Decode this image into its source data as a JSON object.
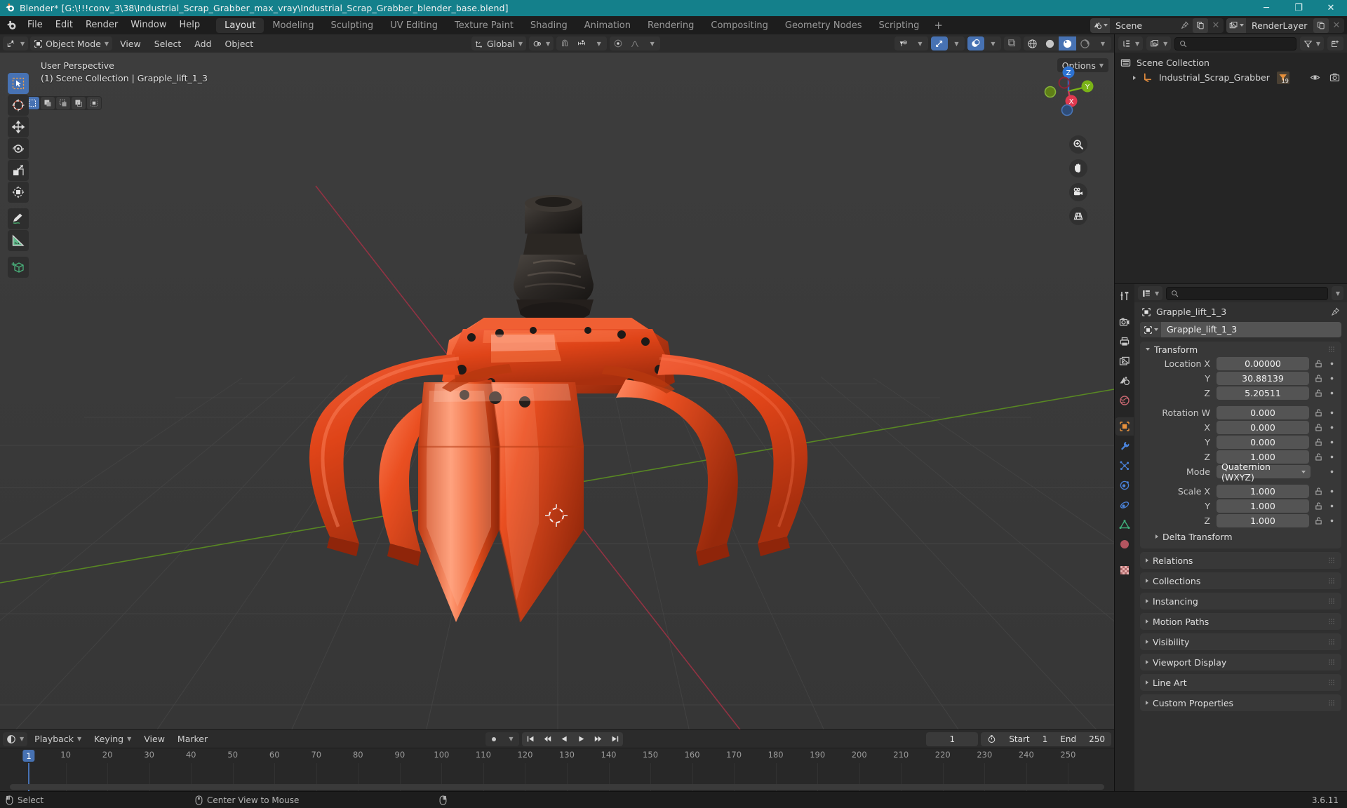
{
  "window": {
    "title": "Blender* [G:\\!!!conv_3\\38\\Industrial_Scrap_Grabber_max_vray\\Industrial_Scrap_Grabber_blender_base.blend]",
    "minimize": "─",
    "maximize": "❐",
    "close": "✕"
  },
  "topbar": {
    "menus": [
      "File",
      "Edit",
      "Render",
      "Window",
      "Help"
    ],
    "workspaces": [
      {
        "label": "Layout",
        "active": true
      },
      {
        "label": "Modeling",
        "active": false
      },
      {
        "label": "Sculpting",
        "active": false
      },
      {
        "label": "UV Editing",
        "active": false
      },
      {
        "label": "Texture Paint",
        "active": false
      },
      {
        "label": "Shading",
        "active": false
      },
      {
        "label": "Animation",
        "active": false
      },
      {
        "label": "Rendering",
        "active": false
      },
      {
        "label": "Compositing",
        "active": false
      },
      {
        "label": "Geometry Nodes",
        "active": false
      },
      {
        "label": "Scripting",
        "active": false
      }
    ],
    "add_workspace": "+",
    "scene_name": "Scene",
    "view_layer_name": "RenderLayer"
  },
  "viewport_header": {
    "mode": "Object Mode",
    "menus": [
      "View",
      "Select",
      "Add",
      "Object"
    ],
    "transform_orientation": "Global",
    "options_label": "Options"
  },
  "viewport": {
    "perspective": "User Perspective",
    "scene_info": "(1) Scene Collection | Grapple_lift_1_3",
    "gizmo_axes": [
      "Z",
      "Y",
      "X"
    ],
    "tools": [
      "tweak-select-tool",
      "cursor-tool",
      "move-tool",
      "rotate-tool",
      "scale-tool",
      "transform-tool",
      "annotate-tool",
      "measure-tool",
      "add-cube-tool"
    ],
    "nav_buttons": [
      "zoom-icon",
      "pan-hand-icon",
      "camera-icon",
      "grid-ortho-icon"
    ]
  },
  "outliner": {
    "search_placeholder": "",
    "items": [
      {
        "label": "Scene Collection",
        "level": 0,
        "icon": "collection-icon"
      },
      {
        "label": "Industrial_Scrap_Grabber",
        "level": 1,
        "icon": "empty-axes-icon",
        "badge": "19"
      }
    ]
  },
  "properties": {
    "breadcrumb": "Grapple_lift_1_3",
    "object_name": "Grapple_lift_1_3",
    "search_placeholder": "",
    "transform": {
      "title": "Transform",
      "rows": [
        {
          "label": "Location X",
          "value": "0.00000"
        },
        {
          "label": "Y",
          "value": "30.88139"
        },
        {
          "label": "Z",
          "value": "5.20511"
        },
        {
          "gap": true
        },
        {
          "label": "Rotation W",
          "value": "0.000"
        },
        {
          "label": "X",
          "value": "0.000"
        },
        {
          "label": "Y",
          "value": "0.000"
        },
        {
          "label": "Z",
          "value": "1.000"
        },
        {
          "label": "Mode",
          "value": "Quaternion (WXYZ)",
          "select": true
        },
        {
          "gap": true
        },
        {
          "label": "Scale X",
          "value": "1.000"
        },
        {
          "label": "Y",
          "value": "1.000"
        },
        {
          "label": "Z",
          "value": "1.000"
        }
      ],
      "sub_panel": "Delta Transform"
    },
    "panels": [
      "Relations",
      "Collections",
      "Instancing",
      "Motion Paths",
      "Visibility",
      "Viewport Display",
      "Line Art",
      "Custom Properties"
    ],
    "tabs": [
      "tool-icon",
      "render-icon",
      "output-icon",
      "view-layer-icon",
      "scene-icon",
      "world-icon",
      "object-icon",
      "modifier-icon",
      "particles-icon",
      "physics-icon",
      "constraints-icon",
      "data-icon",
      "material-icon",
      "texture-icon"
    ]
  },
  "timeline": {
    "menus": [
      "Playback",
      "Keying",
      "View",
      "Marker"
    ],
    "current_frame": "1",
    "start_label": "Start",
    "start_value": "1",
    "end_label": "End",
    "end_value": "250",
    "ticks": [
      {
        "label": "1",
        "frame": 1
      },
      {
        "label": "10",
        "frame": 10
      },
      {
        "label": "20",
        "frame": 20
      },
      {
        "label": "30",
        "frame": 30
      },
      {
        "label": "40",
        "frame": 40
      },
      {
        "label": "50",
        "frame": 50
      },
      {
        "label": "60",
        "frame": 60
      },
      {
        "label": "70",
        "frame": 70
      },
      {
        "label": "80",
        "frame": 80
      },
      {
        "label": "90",
        "frame": 90
      },
      {
        "label": "100",
        "frame": 100
      },
      {
        "label": "110",
        "frame": 110
      },
      {
        "label": "120",
        "frame": 120
      },
      {
        "label": "130",
        "frame": 130
      },
      {
        "label": "140",
        "frame": 140
      },
      {
        "label": "150",
        "frame": 150
      },
      {
        "label": "160",
        "frame": 160
      },
      {
        "label": "170",
        "frame": 170
      },
      {
        "label": "180",
        "frame": 180
      },
      {
        "label": "190",
        "frame": 190
      },
      {
        "label": "200",
        "frame": 200
      },
      {
        "label": "210",
        "frame": 210
      },
      {
        "label": "220",
        "frame": 220
      },
      {
        "label": "230",
        "frame": 230
      },
      {
        "label": "240",
        "frame": 240
      },
      {
        "label": "250",
        "frame": 250
      }
    ]
  },
  "statusbar": {
    "items": [
      {
        "icon": "mouse-left-icon",
        "label": "Select"
      },
      {
        "icon": "mouse-middle-icon",
        "label": "Center View to Mouse"
      },
      {
        "icon": "mouse-right-icon",
        "label": ""
      }
    ],
    "version": "3.6.11"
  },
  "colors": {
    "title_bar": "#14808b",
    "accent_blue": "#4772b3",
    "model_orange": "#e24a1b",
    "axis_x": "#c9405a",
    "axis_y": "#7ab317",
    "axis_z": "#2d72d1",
    "panel_bg": "#303030",
    "viewport_bg": "#393939"
  }
}
